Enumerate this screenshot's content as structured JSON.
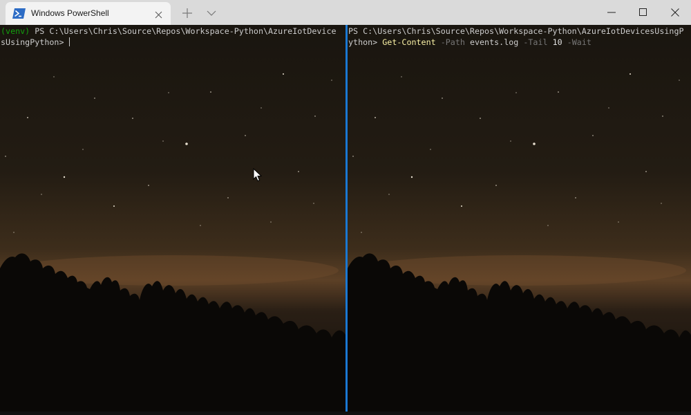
{
  "window": {
    "tab_title": "Windows PowerShell"
  },
  "left_pane": {
    "venv_prefix": "(venv)",
    "prompt_line1": " PS C:\\Users\\Chris\\Source\\Repos\\Workspace-Python\\AzureIotDevice",
    "prompt_line2": "sUsingPython> "
  },
  "right_pane": {
    "prompt_line1": "PS C:\\Users\\Chris\\Source\\Repos\\Workspace-Python\\AzureIotDevicesUsingP",
    "prompt_line2": "ython> ",
    "command": "Get-Content",
    "param_path": " -Path",
    "arg_path": " events.log",
    "param_tail": " -Tail",
    "arg_tail": " 10",
    "param_wait": " -Wait"
  },
  "colors": {
    "venv": "#13a10e",
    "command": "#f9f1a5",
    "parameter": "#767676",
    "pane_divider": "#1a78d3",
    "titlebar": "#dadada"
  },
  "icons": {
    "tab": "powershell-icon",
    "tab_close": "close-icon",
    "new_tab": "plus-icon",
    "dropdown": "chevron-down-icon",
    "minimize": "minimize-icon",
    "maximize": "maximize-icon",
    "close": "close-icon"
  }
}
